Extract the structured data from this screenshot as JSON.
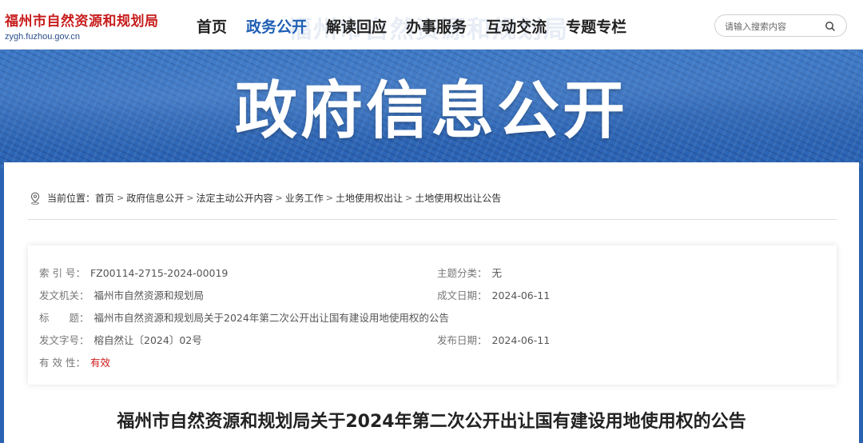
{
  "header": {
    "logo_title": "福州市自然资源和规划局",
    "logo_domain": "zygh.fuzhou.gov.cn",
    "nav": [
      {
        "label": "首页"
      },
      {
        "label": "政务公开"
      },
      {
        "label": "解读回应"
      },
      {
        "label": "办事服务"
      },
      {
        "label": "互动交流"
      },
      {
        "label": "专题专栏"
      }
    ],
    "ghost_text": "福州市自然资源和规划局",
    "search": {
      "placeholder": "请输入搜索内容"
    }
  },
  "banner": {
    "title": "政府信息公开"
  },
  "breadcrumb": {
    "prefix": "当前位置：",
    "items": [
      "首页",
      "政府信息公开",
      "法定主动公开内容",
      "业务工作",
      "土地使用权出让",
      "土地使用权出让公告"
    ],
    "separator": ">"
  },
  "meta": {
    "index_label": "索 引 号：",
    "index_value": "FZ00114-2715-2024-00019",
    "topic_label": "主题分类：",
    "topic_value": "无",
    "issuer_label": "发文机关：",
    "issuer_value": "福州市自然资源和规划局",
    "created_label": "成文日期：",
    "created_value": "2024-06-11",
    "title_label": "标　　题：",
    "title_value": "福州市自然资源和规划局关于2024年第二次公开出让国有建设用地使用权的公告",
    "docno_label": "发文字号：",
    "docno_value": "榕自然让〔2024〕02号",
    "published_label": "发布日期：",
    "published_value": "2024-06-11",
    "validity_label": "有 效 性：",
    "validity_value": "有效"
  },
  "article": {
    "title": "福州市自然资源和规划局关于2024年第二次公开出让国有建设用地使用权的公告"
  },
  "colors": {
    "accent": "#1f5fb5",
    "logo_red": "#c81d1d",
    "banner_blue": "#2a63b3",
    "valid_red": "#d21a1a"
  }
}
